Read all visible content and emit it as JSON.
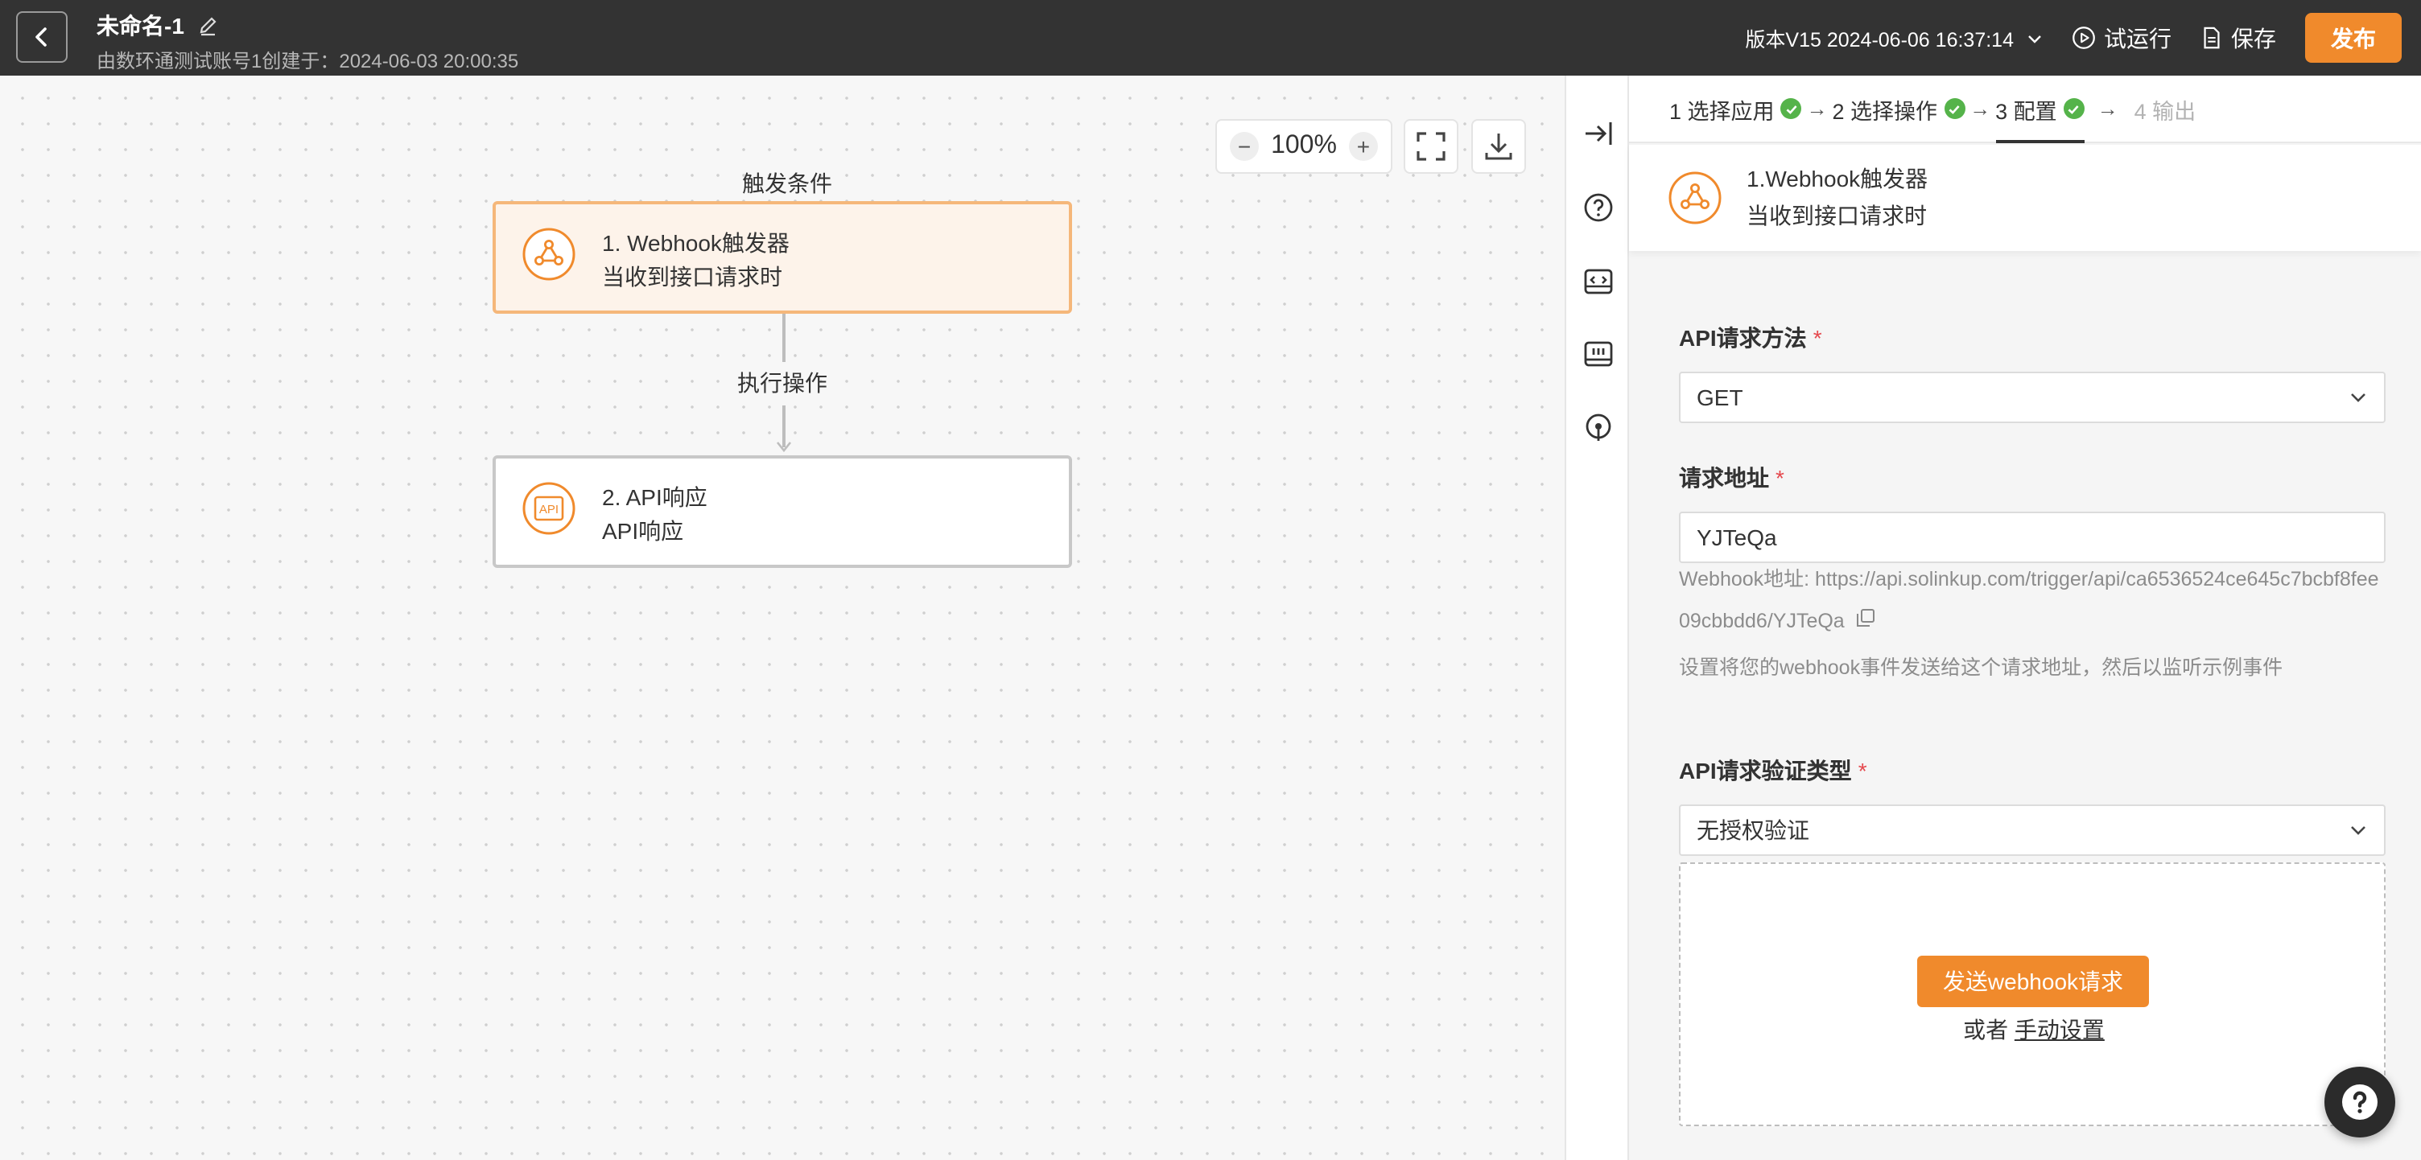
{
  "header": {
    "title": "未命名-1",
    "subtitle": "由数环通测试账号1创建于：2024-06-03 20:00:35",
    "version": "版本V15 2024-06-06 16:37:14",
    "test_run_label": "试运行",
    "save_label": "保存",
    "publish_label": "发布"
  },
  "canvas": {
    "zoom": "100%",
    "trigger_label": "触发条件",
    "action_label": "执行操作",
    "nodes": [
      {
        "title": "1. Webhook触发器",
        "subtitle": "当收到接口请求时",
        "icon": "webhook-icon"
      },
      {
        "title": "2. API响应",
        "subtitle": "API响应",
        "icon": "api-icon"
      }
    ]
  },
  "side_icons": [
    "collapse-panel-icon",
    "help-circle-icon",
    "code-icon",
    "log-icon",
    "pin-icon"
  ],
  "panel": {
    "steps": [
      {
        "label": "1 选择应用",
        "done": true
      },
      {
        "label": "2 选择操作",
        "done": true
      },
      {
        "label": "3 配置",
        "done": true
      },
      {
        "label": "4 输出",
        "done": false
      }
    ],
    "head_title": "1.Webhook触发器",
    "head_subtitle": "当收到接口请求时",
    "method_label": "API请求方法",
    "method_value": "GET",
    "url_label": "请求地址",
    "url_value": "YJTeQa",
    "webhook_url": "Webhook地址: https://api.solinkup.com/trigger/api/ca6536524ce645c7bcbf8fee09cbbdd6/YJTeQa",
    "webhook_hint": "设置将您的webhook事件发送给这个请求地址，然后以监听示例事件",
    "auth_label": "API请求验证类型",
    "auth_value": "无授权验证",
    "send_button": "发送webhook请求",
    "or_text": "或者",
    "manual_link": "手动设置"
  },
  "colors": {
    "accent": "#f08a2c",
    "topbar": "#333333",
    "success": "#55b34a",
    "required": "#e5484d"
  }
}
